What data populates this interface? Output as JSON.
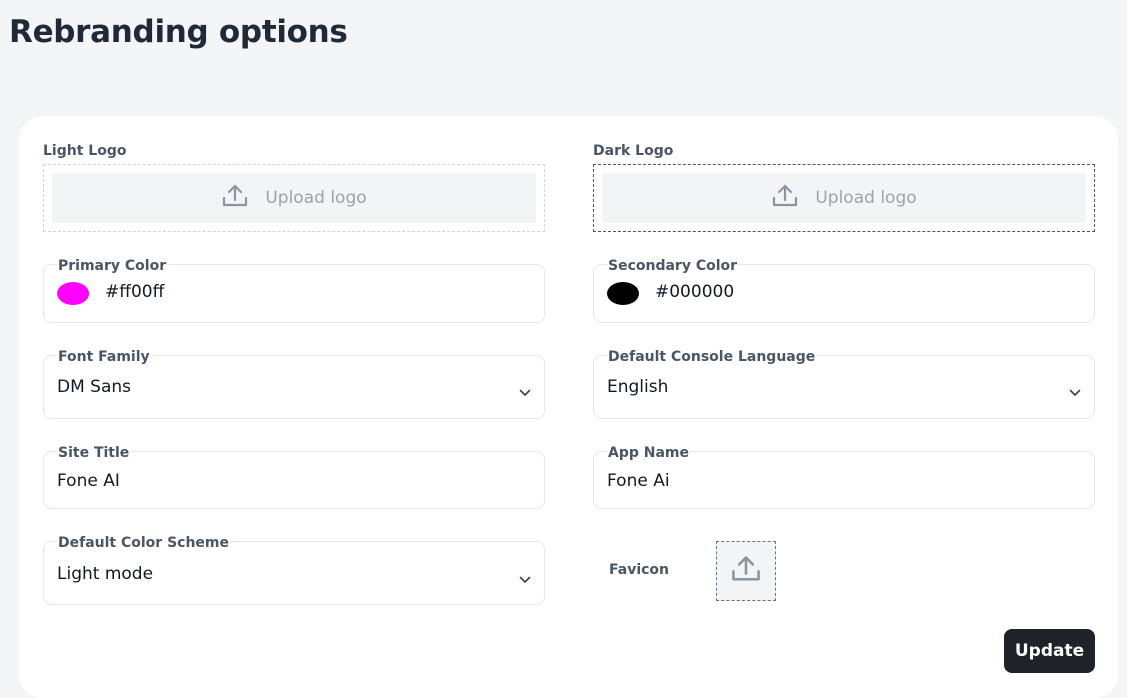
{
  "page": {
    "title": "Rebranding options"
  },
  "light_logo": {
    "label": "Light Logo",
    "upload_text": "Upload logo",
    "icon": "upload-icon"
  },
  "dark_logo": {
    "label": "Dark Logo",
    "upload_text": "Upload logo",
    "icon": "upload-icon"
  },
  "primary_color": {
    "label": "Primary Color",
    "value": "#ff00ff",
    "swatch_color": "#ff00ff"
  },
  "secondary_color": {
    "label": "Secondary Color",
    "value": "#000000",
    "swatch_color": "#000000"
  },
  "font_family": {
    "label": "Font Family",
    "value": "DM Sans",
    "icon": "chevron-down-icon"
  },
  "console_language": {
    "label": "Default Console Language",
    "value": "English",
    "icon": "chevron-down-icon"
  },
  "site_title": {
    "label": "Site Title",
    "value": "Fone AI"
  },
  "app_name": {
    "label": "App Name",
    "value": "Fone Ai"
  },
  "color_scheme": {
    "label": "Default Color Scheme",
    "value": "Light mode",
    "icon": "chevron-down-icon"
  },
  "favicon": {
    "label": "Favicon",
    "icon": "upload-icon"
  },
  "actions": {
    "update_label": "Update"
  }
}
